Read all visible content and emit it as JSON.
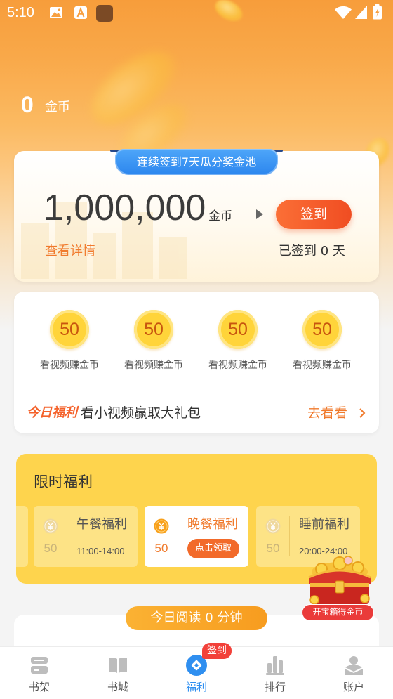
{
  "status_bar": {
    "time": "5:10",
    "left_icons": [
      "gallery-icon",
      "font-icon",
      "app-icon"
    ],
    "right_icons": [
      "wifi-icon",
      "signal-icon",
      "battery-icon"
    ]
  },
  "header": {
    "coin_count": "0",
    "coin_unit": "金币"
  },
  "checkin_card": {
    "banner": "连续签到7天瓜分奖金池",
    "pool_amount": "1,000,000",
    "pool_unit": "金币",
    "checkin_button": "签到",
    "details_link": "查看详情",
    "checked_days": "已签到 0 天"
  },
  "video_tasks": {
    "items": [
      {
        "coins": "50",
        "label": "看视频赚金币"
      },
      {
        "coins": "50",
        "label": "看视频赚金币"
      },
      {
        "coins": "50",
        "label": "看视频赚金币"
      },
      {
        "coins": "50",
        "label": "看视频赚金币"
      }
    ],
    "promo": {
      "tag": "今日福利",
      "text": "看小视频赢取大礼包",
      "link": "去看看"
    }
  },
  "limited_welfare": {
    "title": "限时福利",
    "slots": [
      {
        "name": "午餐福利",
        "coins": "50",
        "time": "11:00-14:00",
        "active": false
      },
      {
        "name": "晚餐福利",
        "coins": "50",
        "action": "点击领取",
        "active": true
      },
      {
        "name": "睡前福利",
        "coins": "50",
        "time": "20:00-24:00",
        "active": false
      }
    ]
  },
  "treasure_box": {
    "label": "开宝箱得金币",
    "icon": "treasure-chest-icon"
  },
  "reading": {
    "pill": "今日阅读 0 分钟"
  },
  "bottom_nav": {
    "badge": "签到",
    "active_index": 2,
    "items": [
      {
        "label": "书架",
        "icon": "bookshelf-icon"
      },
      {
        "label": "书城",
        "icon": "book-icon"
      },
      {
        "label": "福利",
        "icon": "welfare-icon"
      },
      {
        "label": "排行",
        "icon": "ranking-icon"
      },
      {
        "label": "账户",
        "icon": "account-icon"
      }
    ]
  },
  "colors": {
    "header_orange": "#f79d3b",
    "banner_blue": "#3492f0",
    "accent_orange": "#f26a2a",
    "link_orange": "#f07a2c",
    "card_yellow": "#fed44d",
    "coin_yellow": "#ffd43a",
    "active_nav_blue": "#2f8ff0",
    "badge_red": "#f2413a"
  }
}
